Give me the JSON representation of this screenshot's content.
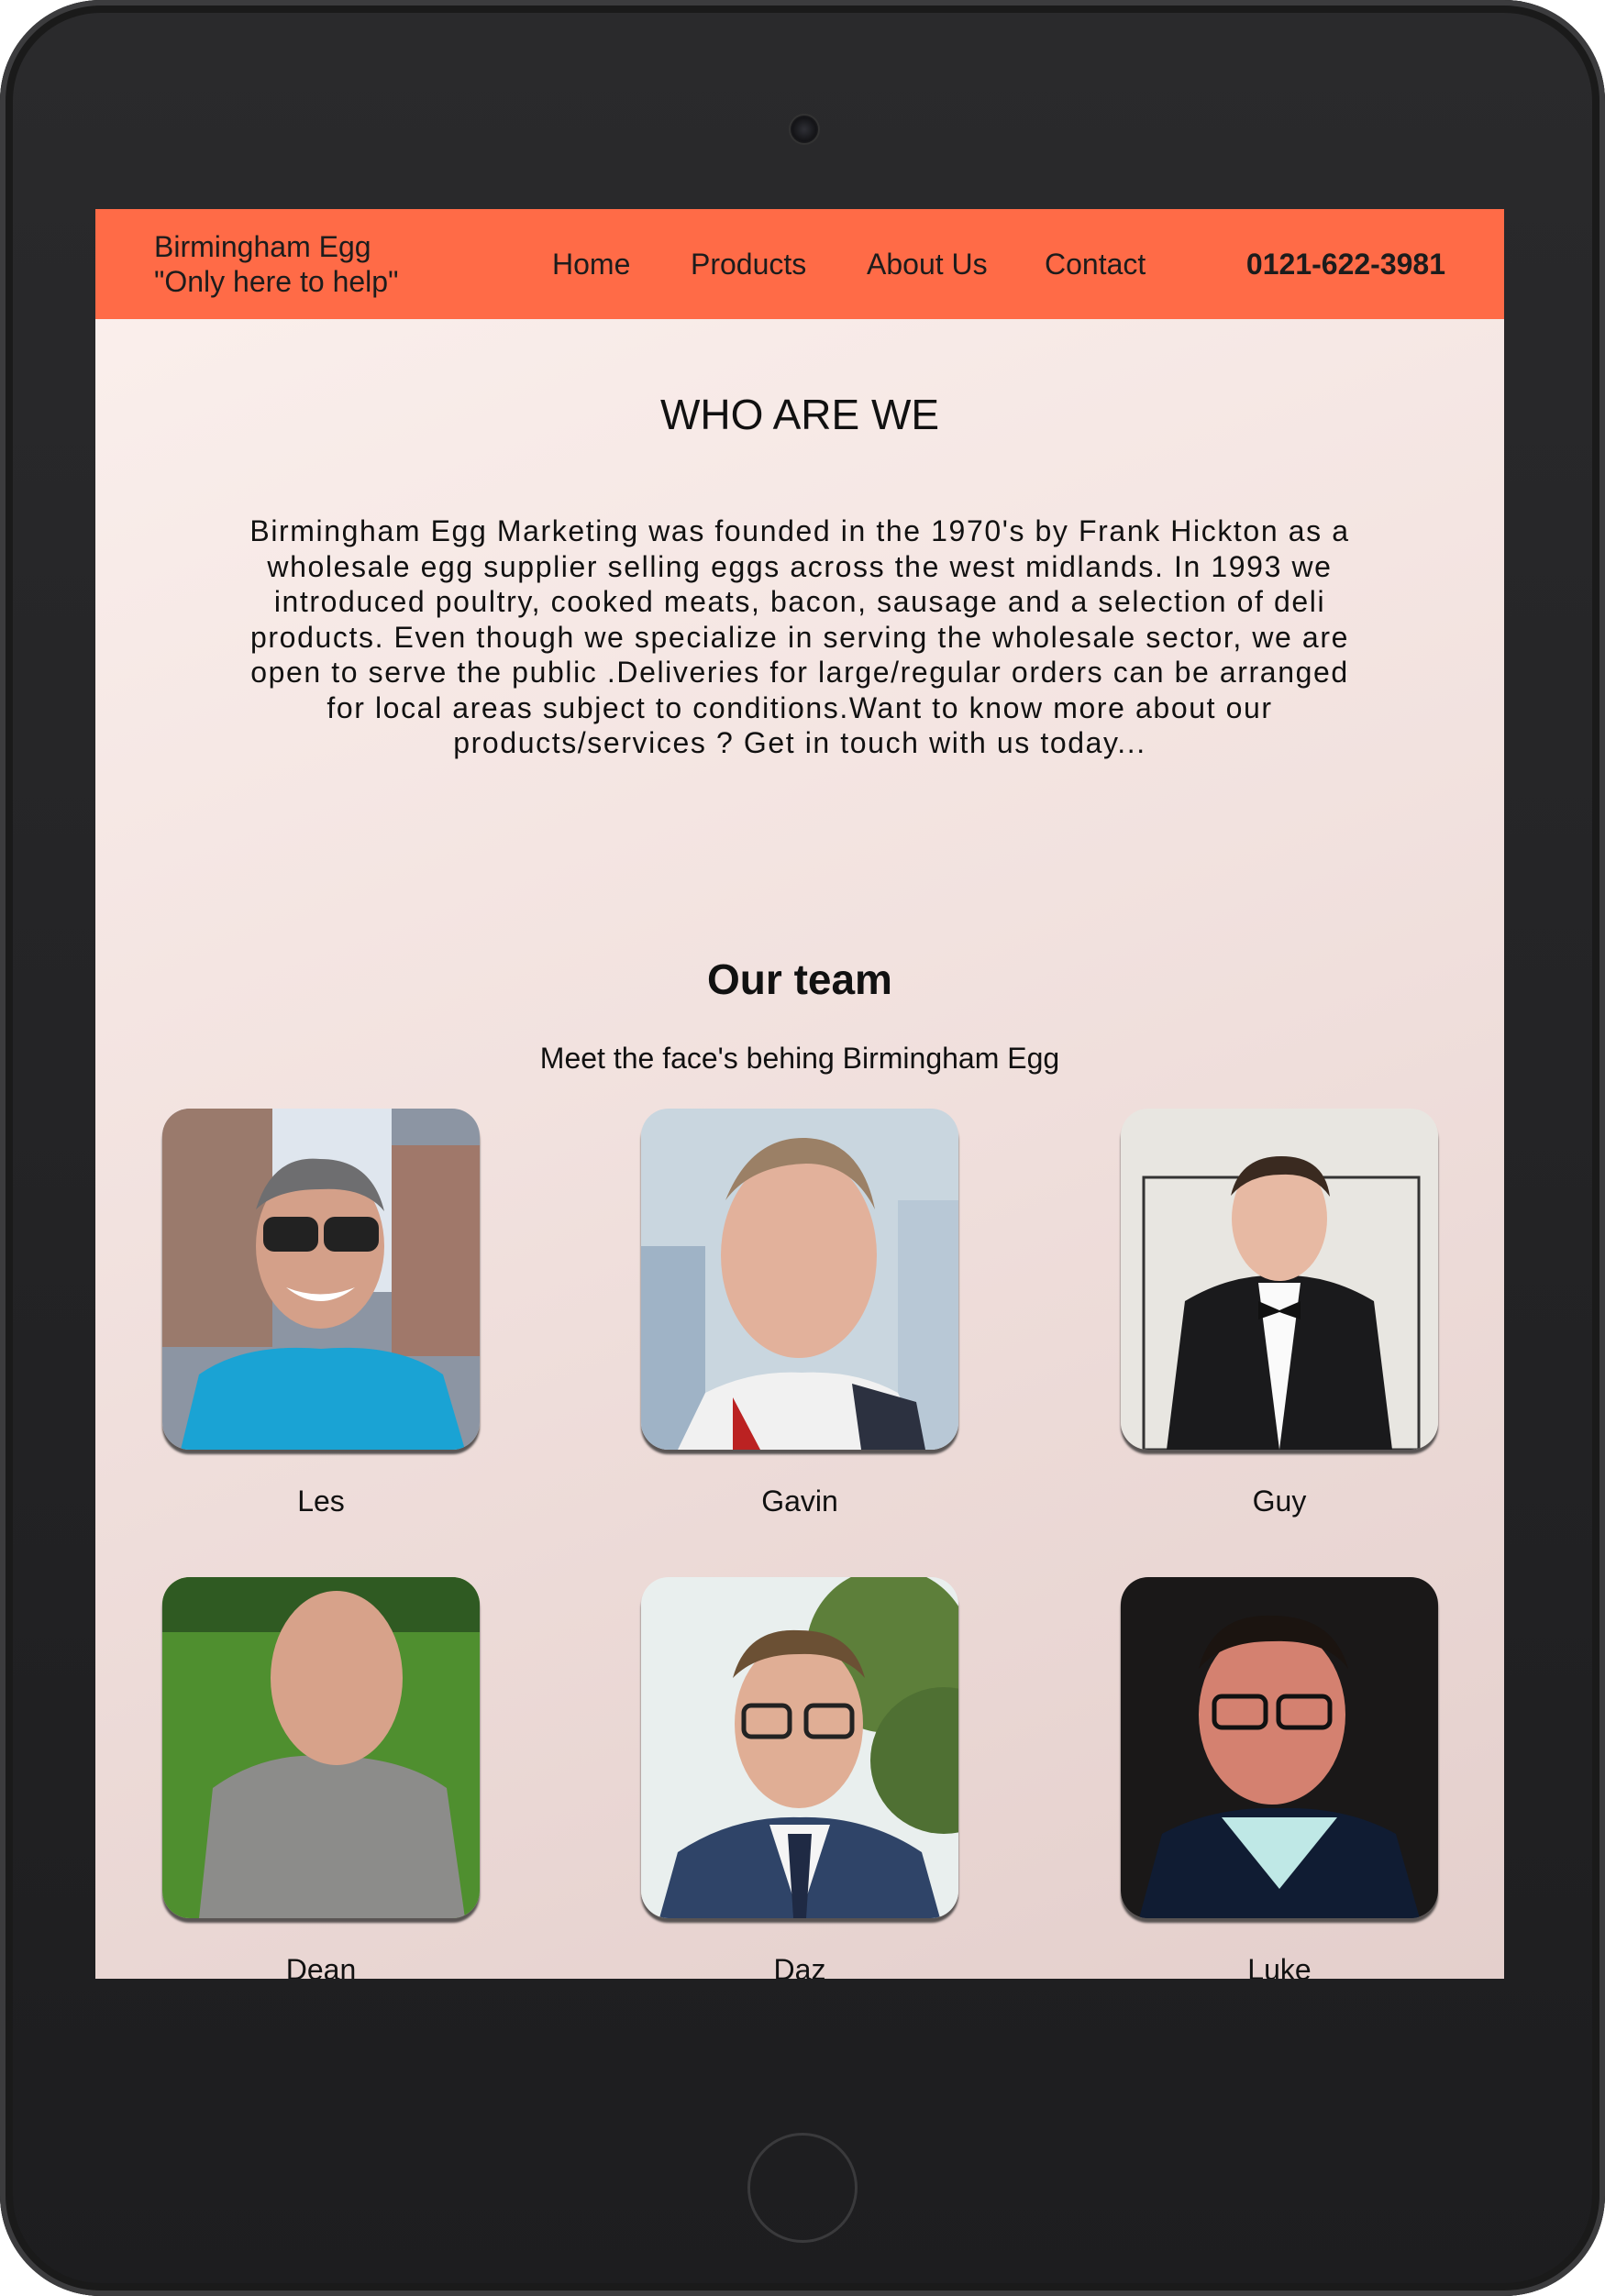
{
  "header": {
    "brand_line1": "Birmingham Egg",
    "brand_line2": "\"Only here to help\"",
    "nav": [
      "Home",
      "Products",
      "About Us",
      "Contact"
    ],
    "phone": "0121-622-3981",
    "accent_color": "#ff6b47"
  },
  "about": {
    "title": "WHO ARE WE",
    "text": "Birmingham Egg Marketing was founded in the 1970's by Frank Hickton as a wholesale egg supplier selling eggs across the west midlands. In 1993 we introduced poultry, cooked meats, bacon, sausage and a selection of deli products. Even though we specialize in serving the wholesale sector, we are open to serve the public .Deliveries for large/regular orders can be arranged for local areas subject to conditions.Want to know more about our products/services ? Get in touch with us today..."
  },
  "team": {
    "title": "Our team",
    "subtitle": "Meet the face's behing Birmingham Egg",
    "members": [
      {
        "name": "Les"
      },
      {
        "name": "Gavin"
      },
      {
        "name": "Guy"
      },
      {
        "name": "Dean"
      },
      {
        "name": "Daz"
      },
      {
        "name": "Luke"
      }
    ]
  }
}
